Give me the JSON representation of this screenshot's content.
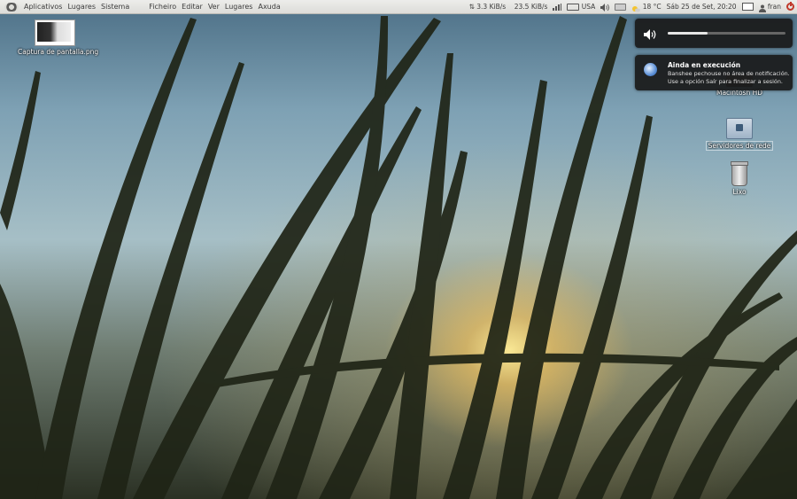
{
  "top_panel": {
    "menus": [
      "Aplicativos",
      "Lugares",
      "Sistema"
    ],
    "app_menus": [
      "Ficheiro",
      "Editar",
      "Ver",
      "Lugares",
      "Axuda"
    ],
    "tray": {
      "upload_speed": "3.3 KiB/s",
      "download_speed": "23.5 KiB/s",
      "keyboard_layout": "USA",
      "temperature": "18 °C",
      "clock": "Sáb 25 de Set, 20:20",
      "user_name": "fran"
    }
  },
  "desktop": {
    "icons": [
      {
        "label": "Captura de pantalla.png",
        "icon": "image-file-icon"
      },
      {
        "label": "Macintosh HD",
        "icon": "hard-drive-icon"
      },
      {
        "label": "Servidores de rede",
        "icon": "network-folder-icon"
      },
      {
        "label": "Lixo",
        "icon": "trash-icon"
      }
    ]
  },
  "volume_osd": {
    "level": 0.34
  },
  "notification": {
    "title": "Ainda en execución",
    "body": "Banshee pechouse no área de notificación. Use a opción Saír para finalizar a sesión.",
    "icon": "banshee-icon"
  },
  "colors": {
    "panel_bg": "#dcdcd8",
    "osd_bg": "#191919",
    "power": "#c0392b"
  }
}
